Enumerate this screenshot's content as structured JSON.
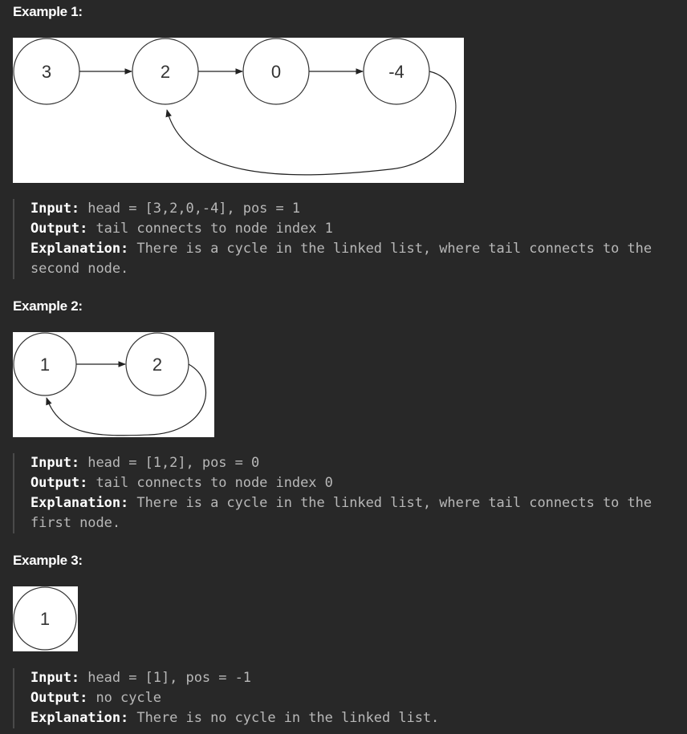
{
  "examples": [
    {
      "heading": "Example 1:",
      "nodes": [
        "3",
        "2",
        "0",
        "-4"
      ],
      "input_label": "Input:",
      "input_value": " head = [3,2,0,-4], pos = 1",
      "output_label": "Output:",
      "output_value": " tail connects to node index 1",
      "explanation_label": "Explanation:",
      "explanation_value": " There is a cycle in the linked list, where tail connects to the second node."
    },
    {
      "heading": "Example 2:",
      "nodes": [
        "1",
        "2"
      ],
      "input_label": "Input:",
      "input_value": " head = [1,2], pos = 0",
      "output_label": "Output:",
      "output_value": " tail connects to node index 0",
      "explanation_label": "Explanation:",
      "explanation_value": " There is a cycle in the linked list, where tail connects to the first node."
    },
    {
      "heading": "Example 3:",
      "nodes": [
        "1"
      ],
      "input_label": "Input:",
      "input_value": " head = [1], pos = -1",
      "output_label": "Output:",
      "output_value": " no cycle",
      "explanation_label": "Explanation:",
      "explanation_value": " There is no cycle in the linked list."
    }
  ]
}
